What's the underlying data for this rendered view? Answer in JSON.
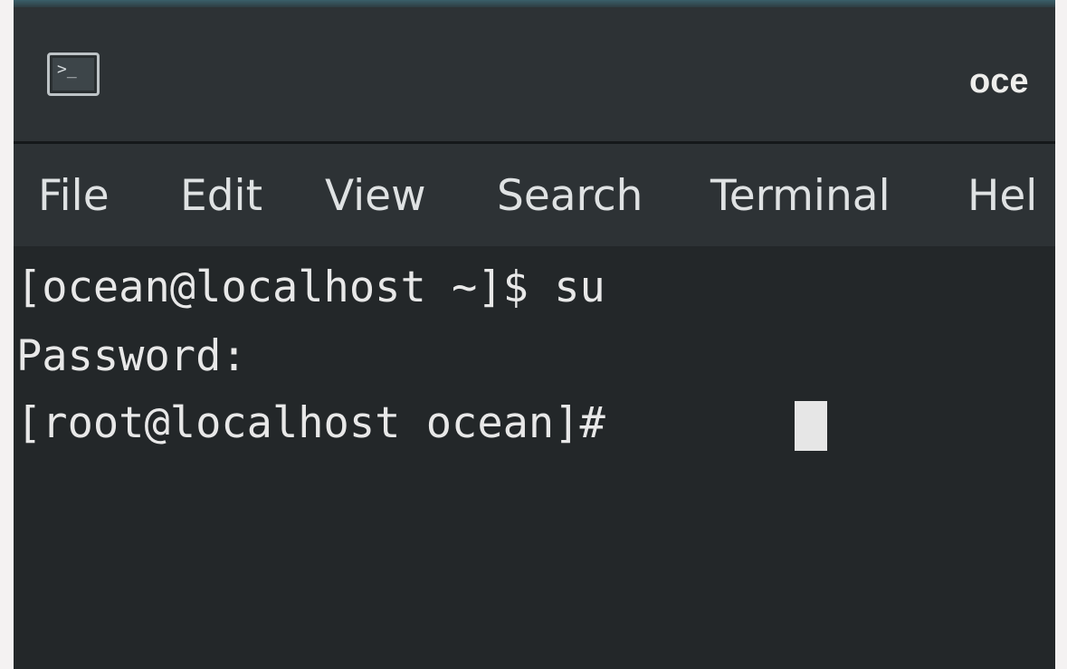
{
  "window": {
    "title": "oce",
    "icon": "terminal-icon"
  },
  "menu": {
    "items": [
      {
        "id": "file",
        "label": "File"
      },
      {
        "id": "edit",
        "label": "Edit"
      },
      {
        "id": "view",
        "label": "View"
      },
      {
        "id": "search",
        "label": "Search"
      },
      {
        "id": "terminal",
        "label": "Terminal"
      },
      {
        "id": "help",
        "label": "Hel"
      }
    ]
  },
  "terminal": {
    "lines": [
      "[ocean@localhost ~]$ su",
      "Password:",
      "[root@localhost ocean]# "
    ]
  },
  "colors": {
    "titlebar": "#2d3235",
    "background": "#232729",
    "text": "#e8e8e8",
    "cursor": "#e6e6e6"
  }
}
